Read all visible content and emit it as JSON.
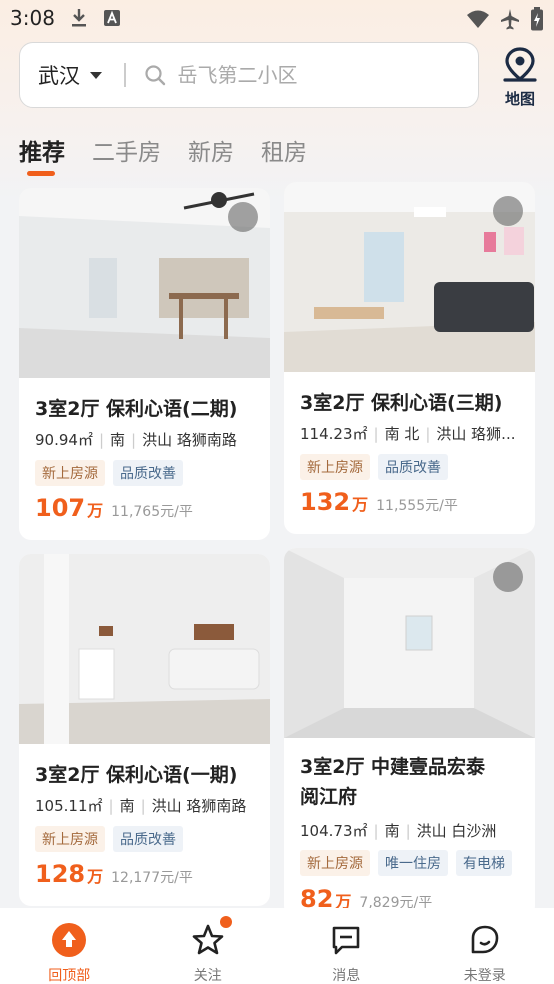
{
  "status_bar": {
    "time": "3:08"
  },
  "search": {
    "city": "武汉",
    "placeholder": "岳飞第二小区",
    "map_label": "地图"
  },
  "tabs": [
    {
      "label": "推荐"
    },
    {
      "label": "二手房"
    },
    {
      "label": "新房"
    },
    {
      "label": "租房"
    }
  ],
  "listings": [
    {
      "title": "3室2厅 保利心语(二期)",
      "area": "90.94㎡",
      "orientation": "南",
      "location": "洪山 珞狮南路",
      "tags": [
        "新上房源",
        "品质改善"
      ],
      "price": "107",
      "price_unit": "万",
      "unit_price": "11,765元/平"
    },
    {
      "title": "3室2厅 保利心语(三期)",
      "area": "114.23㎡",
      "orientation": "南 北",
      "location": "洪山 珞狮...",
      "tags": [
        "新上房源",
        "品质改善"
      ],
      "price": "132",
      "price_unit": "万",
      "unit_price": "11,555元/平"
    },
    {
      "title": "3室2厅 保利心语(一期)",
      "area": "105.11㎡",
      "orientation": "南",
      "location": "洪山 珞狮南路",
      "tags": [
        "新上房源",
        "品质改善"
      ],
      "price": "128",
      "price_unit": "万",
      "unit_price": "12,177元/平"
    },
    {
      "title_line1": "3室2厅 中建壹品宏泰",
      "title_line2": "阅江府",
      "area": "104.73㎡",
      "orientation": "南",
      "location": "洪山 白沙洲",
      "tags": [
        "新上房源",
        "唯一住房",
        "有电梯"
      ],
      "price": "82",
      "price_unit": "万",
      "unit_price": "7,829元/平"
    }
  ],
  "bottom_nav": [
    {
      "label": "回顶部",
      "icon": "back-to-top-icon"
    },
    {
      "label": "关注",
      "icon": "star-icon"
    },
    {
      "label": "消息",
      "icon": "message-icon"
    },
    {
      "label": "未登录",
      "icon": "profile-icon"
    }
  ],
  "colors": {
    "accent": "#f05f1c"
  }
}
